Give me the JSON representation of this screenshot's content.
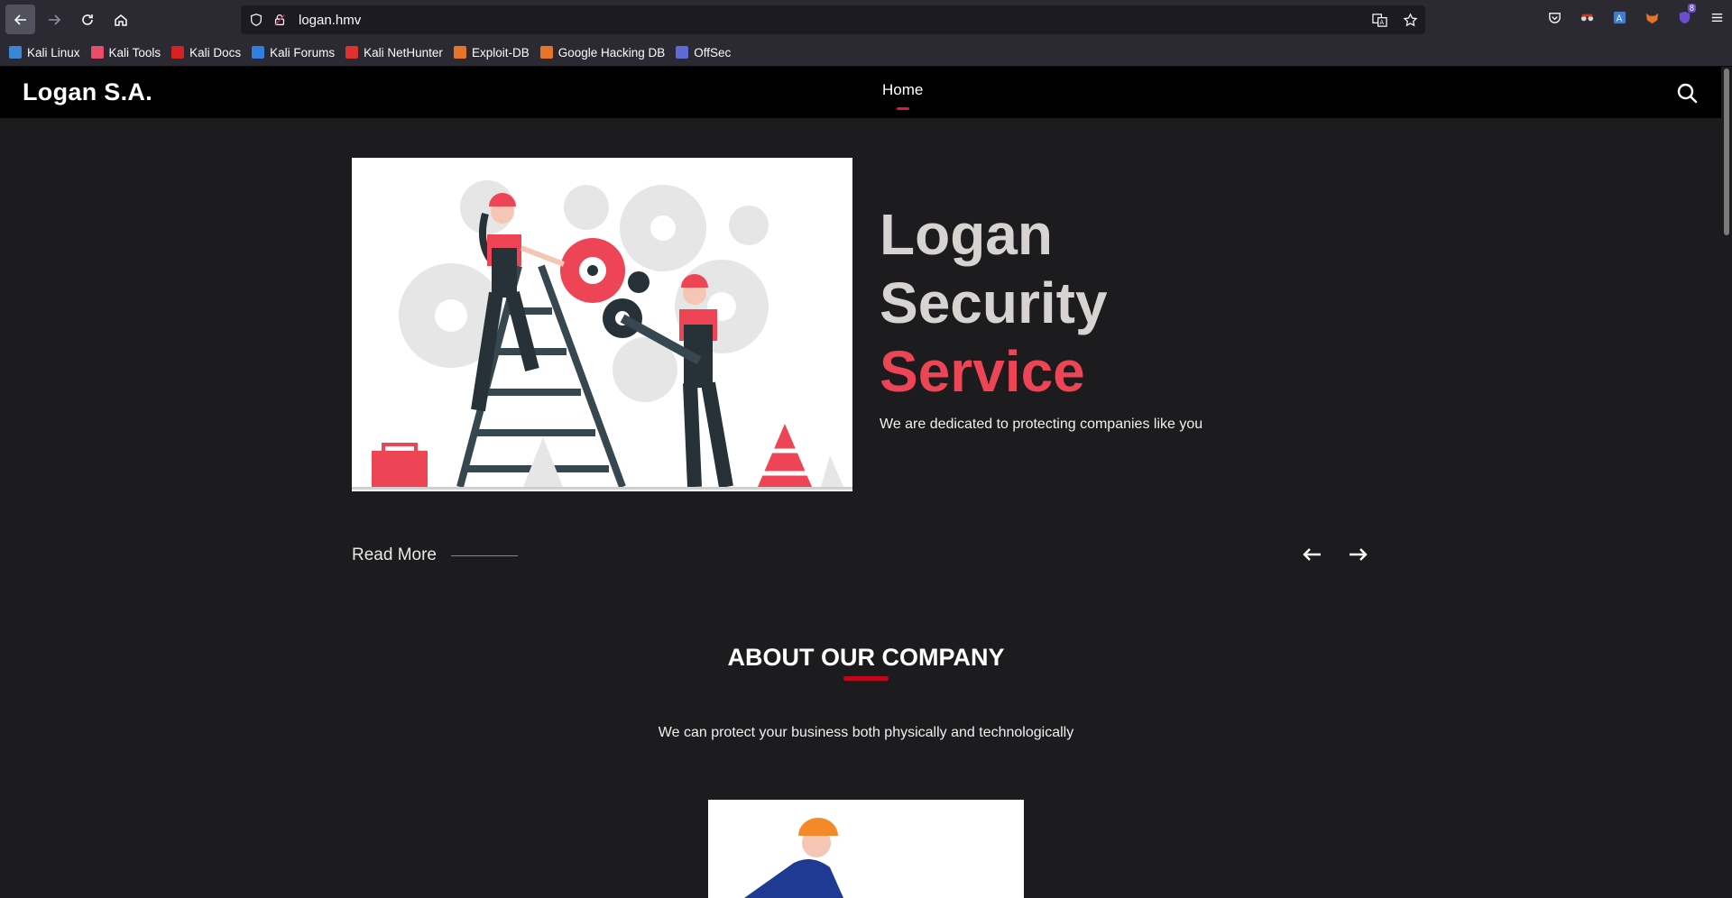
{
  "browser": {
    "url": "logan.hmv",
    "bookmarks": [
      {
        "label": "Kali Linux",
        "color": "#3a86d4"
      },
      {
        "label": "Kali Tools",
        "color": "#e94b6b"
      },
      {
        "label": "Kali Docs",
        "color": "#d62222"
      },
      {
        "label": "Kali Forums",
        "color": "#2f7fde"
      },
      {
        "label": "Kali NetHunter",
        "color": "#e03131"
      },
      {
        "label": "Exploit-DB",
        "color": "#e8742a"
      },
      {
        "label": "Google Hacking DB",
        "color": "#e8742a"
      },
      {
        "label": "OffSec",
        "color": "#5c6bd6"
      }
    ],
    "extension_badge": "8"
  },
  "site": {
    "brand": "Logan S.A.",
    "nav": {
      "home": "Home"
    },
    "accent": "#e01b2f",
    "hero": {
      "title_line1": "Logan",
      "title_line2": "Security",
      "title_line3": "Service",
      "subtitle": "We are dedicated to protecting companies like you",
      "read_more": "Read More"
    },
    "about": {
      "title": "ABOUT OUR COMPANY",
      "text": "We can protect your business both physically and technologically"
    }
  }
}
